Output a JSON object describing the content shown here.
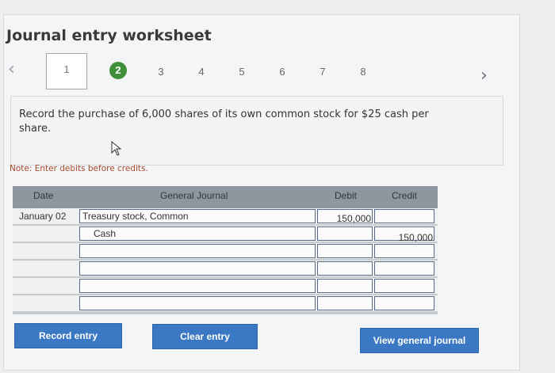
{
  "header": {
    "title": "Journal entry worksheet"
  },
  "nav": {
    "prev_icon": "chevron-left-icon",
    "next_icon": "chevron-right-icon",
    "steps": [
      "1",
      "2",
      "3",
      "4",
      "5",
      "6",
      "7",
      "8"
    ],
    "current_step": "1",
    "completed_step": "2"
  },
  "prompt": {
    "text": "Record the purchase of 6,000 shares of its own common stock for $25 cash per share."
  },
  "note": "Note: Enter debits before credits.",
  "journal": {
    "headers": {
      "date": "Date",
      "account": "General Journal",
      "debit": "Debit",
      "credit": "Credit"
    },
    "rows": [
      {
        "date": "January 02",
        "account": "Treasury stock, Common",
        "debit": "150,000",
        "credit": ""
      },
      {
        "date": "",
        "account": "Cash",
        "debit": "",
        "credit": "150,000"
      },
      {
        "date": "",
        "account": "",
        "debit": "",
        "credit": ""
      },
      {
        "date": "",
        "account": "",
        "debit": "",
        "credit": ""
      },
      {
        "date": "",
        "account": "",
        "debit": "",
        "credit": ""
      },
      {
        "date": "",
        "account": "",
        "debit": "",
        "credit": ""
      }
    ]
  },
  "buttons": {
    "record": "Record entry",
    "clear": "Clear entry",
    "view": "View general journal"
  },
  "colors": {
    "accent": "#3a78c3",
    "done": "#3f8e3a",
    "header": "#8e96a0"
  }
}
